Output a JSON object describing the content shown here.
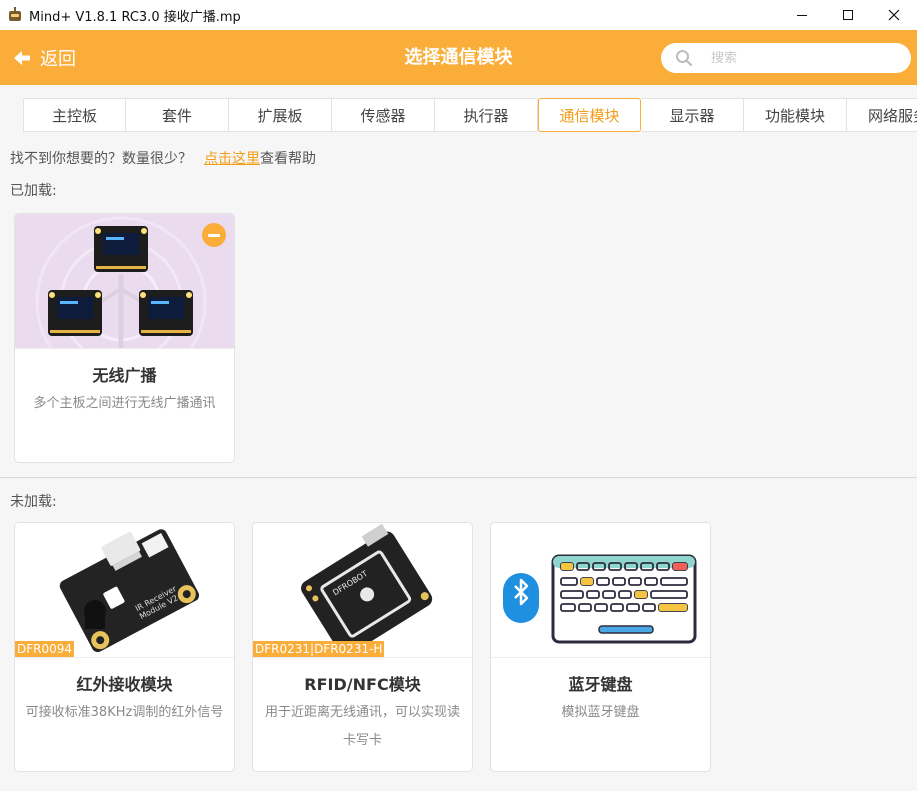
{
  "window": {
    "title": "Mind+ V1.8.1 RC3.0   接收广播.mp"
  },
  "header": {
    "back_label": "返回",
    "title": "选择通信模块",
    "search_placeholder": "搜索"
  },
  "tabs": [
    {
      "label": "主控板"
    },
    {
      "label": "套件"
    },
    {
      "label": "扩展板"
    },
    {
      "label": "传感器"
    },
    {
      "label": "执行器"
    },
    {
      "label": "通信模块",
      "active": true
    },
    {
      "label": "显示器"
    },
    {
      "label": "功能模块"
    },
    {
      "label": "网络服务"
    }
  ],
  "help": {
    "text": "找不到你想要的？数量很少？",
    "link": "点击这里",
    "suffix": "查看帮助"
  },
  "loaded": {
    "label": "已加载:",
    "cards": [
      {
        "name": "无线广播",
        "desc": "多个主板之间进行无线广播通讯"
      }
    ]
  },
  "unloaded": {
    "label": "未加载:",
    "cards": [
      {
        "name": "红外接收模块",
        "desc": "可接收标准38KHz调制的红外信号",
        "sku": "DFR0094"
      },
      {
        "name": "RFID/NFC模块",
        "desc": "用于近距离无线通讯，可以实现读卡写卡",
        "sku": "DFR0231|DFR0231-H"
      },
      {
        "name": "蓝牙键盘",
        "desc": "模拟蓝牙键盘"
      }
    ]
  },
  "colors": {
    "accent": "#fbad3a",
    "accent_text": "#f29c17"
  }
}
